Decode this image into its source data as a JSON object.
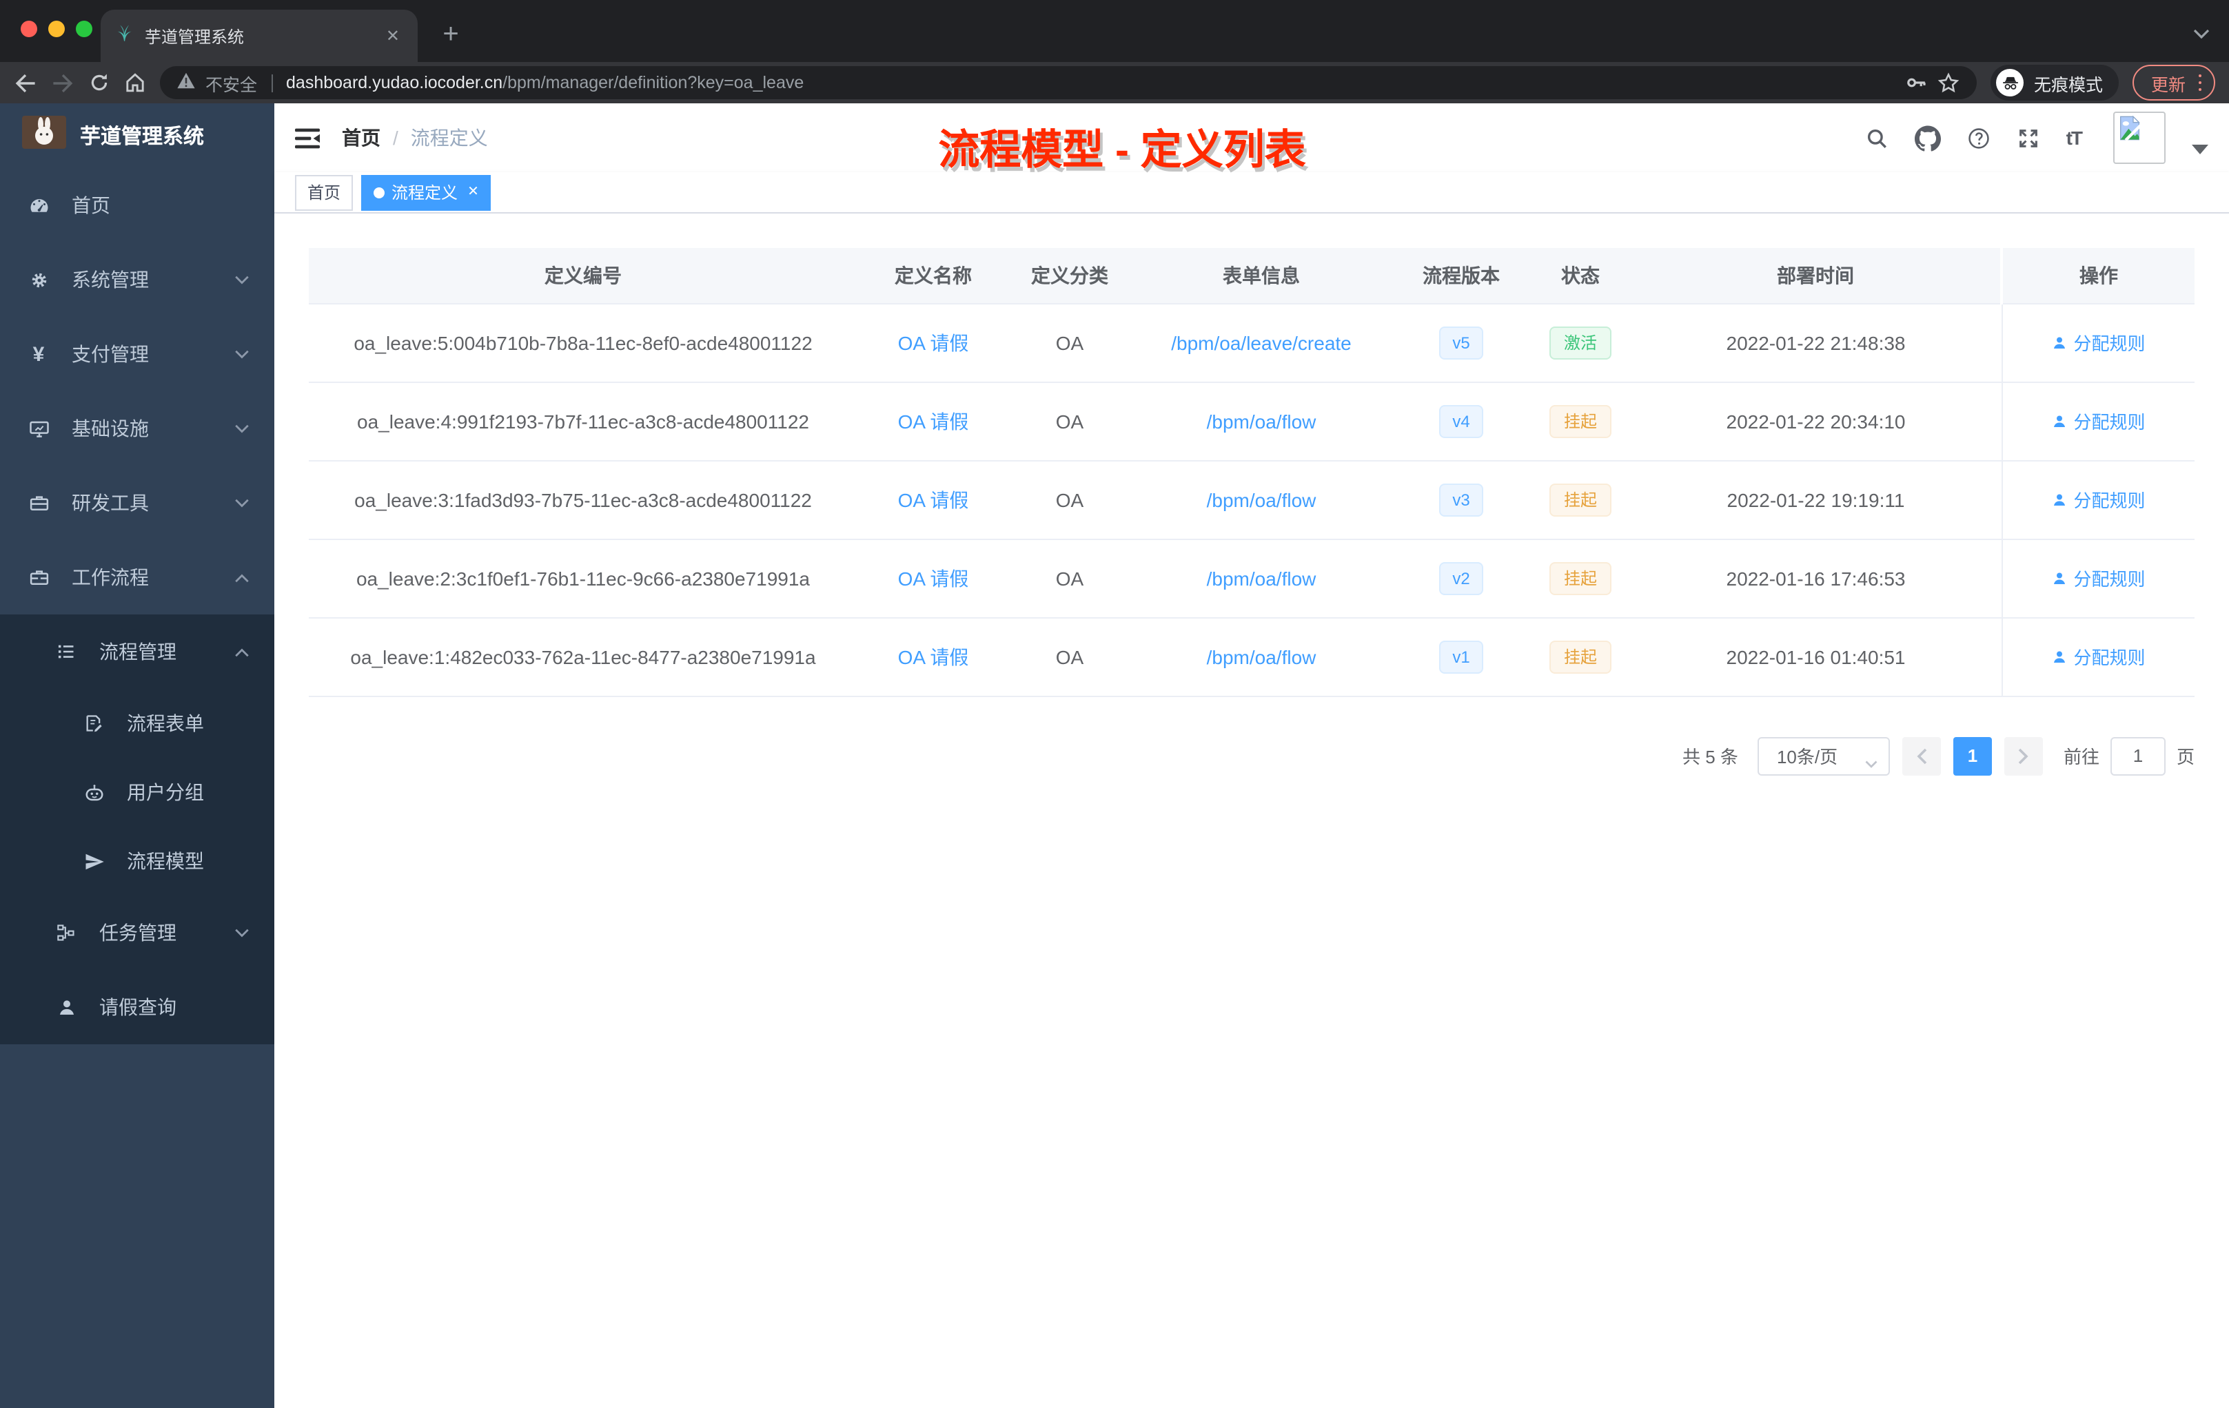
{
  "browser": {
    "tab": {
      "title": "芋道管理系统",
      "close_glyph": "✕",
      "new_tab_glyph": "+"
    },
    "address": {
      "security_label": "不安全",
      "url_host": "dashboard.yudao.iocoder.cn",
      "url_path": "/bpm/manager/definition?key=oa_leave",
      "incognito_label": "无痕模式",
      "update_label": "更新"
    }
  },
  "sidebar": {
    "logo_title": "芋道管理系统",
    "items": [
      {
        "label": "首页",
        "icon": "dashboard-icon",
        "chevron": "none"
      },
      {
        "label": "系统管理",
        "icon": "gear-icon",
        "chevron": "down"
      },
      {
        "label": "支付管理",
        "icon": "yuan-icon",
        "chevron": "down"
      },
      {
        "label": "基础设施",
        "icon": "monitor-icon",
        "chevron": "down"
      },
      {
        "label": "研发工具",
        "icon": "toolbox-icon",
        "chevron": "down"
      },
      {
        "label": "工作流程",
        "icon": "briefcase-icon",
        "chevron": "up"
      },
      {
        "label": "流程管理",
        "icon": "list-icon",
        "chevron": "up"
      },
      {
        "label": "流程表单",
        "icon": "form-icon",
        "chevron": "none"
      },
      {
        "label": "用户分组",
        "icon": "robot-icon",
        "chevron": "none"
      },
      {
        "label": "流程模型",
        "icon": "send-icon",
        "chevron": "none"
      },
      {
        "label": "任务管理",
        "icon": "tree-icon",
        "chevron": "down"
      },
      {
        "label": "请假查询",
        "icon": "person-icon",
        "chevron": "none"
      }
    ]
  },
  "header": {
    "breadcrumb": [
      "首页",
      "流程定义"
    ],
    "breadcrumb_separator": "/",
    "annotation": "流程模型 - 定义列表",
    "text_size_icon_label": "tT"
  },
  "tags": [
    {
      "label": "首页",
      "active": false
    },
    {
      "label": "流程定义",
      "active": true
    }
  ],
  "table": {
    "columns": [
      "定义编号",
      "定义名称",
      "定义分类",
      "表单信息",
      "流程版本",
      "状态",
      "部署时间",
      "操作"
    ],
    "rows": [
      {
        "id": "oa_leave:5:004b710b-7b8a-11ec-8ef0-acde48001122",
        "name": "OA 请假",
        "category": "OA",
        "form": "/bpm/oa/leave/create",
        "version": "v5",
        "status": "激活",
        "status_type": "success",
        "deploy_time": "2022-01-22 21:48:38",
        "action": "分配规则"
      },
      {
        "id": "oa_leave:4:991f2193-7b7f-11ec-a3c8-acde48001122",
        "name": "OA 请假",
        "category": "OA",
        "form": "/bpm/oa/flow",
        "version": "v4",
        "status": "挂起",
        "status_type": "warning",
        "deploy_time": "2022-01-22 20:34:10",
        "action": "分配规则"
      },
      {
        "id": "oa_leave:3:1fad3d93-7b75-11ec-a3c8-acde48001122",
        "name": "OA 请假",
        "category": "OA",
        "form": "/bpm/oa/flow",
        "version": "v3",
        "status": "挂起",
        "status_type": "warning",
        "deploy_time": "2022-01-22 19:19:11",
        "action": "分配规则"
      },
      {
        "id": "oa_leave:2:3c1f0ef1-76b1-11ec-9c66-a2380e71991a",
        "name": "OA 请假",
        "category": "OA",
        "form": "/bpm/oa/flow",
        "version": "v2",
        "status": "挂起",
        "status_type": "warning",
        "deploy_time": "2022-01-16 17:46:53",
        "action": "分配规则"
      },
      {
        "id": "oa_leave:1:482ec033-762a-11ec-8477-a2380e71991a",
        "name": "OA 请假",
        "category": "OA",
        "form": "/bpm/oa/flow",
        "version": "v1",
        "status": "挂起",
        "status_type": "warning",
        "deploy_time": "2022-01-16 01:40:51",
        "action": "分配规则"
      }
    ]
  },
  "pagination": {
    "total": "共 5 条",
    "page_size": "10条/页",
    "current_page": "1",
    "goto_label": "前往",
    "goto_value": "1",
    "page_unit": "页"
  },
  "colors": {
    "accent": "#409eff",
    "success": "#3bc579",
    "warning": "#e6a23c",
    "annotation_red": "#ff2a00",
    "sidebar_bg": "#304156",
    "submenu_bg": "#1f2d3d"
  }
}
